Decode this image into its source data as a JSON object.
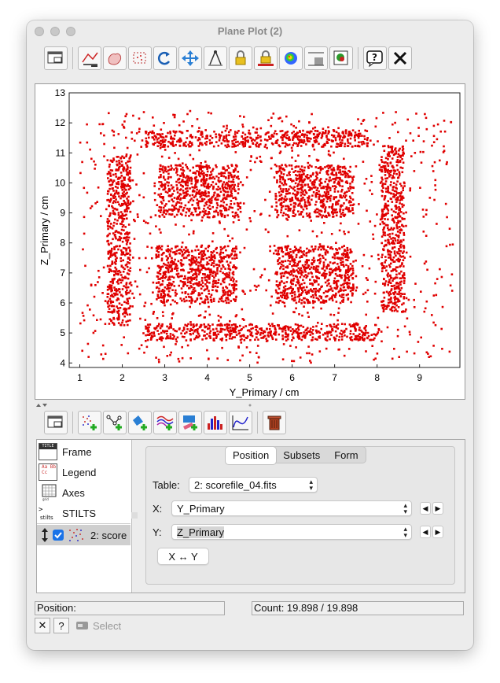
{
  "window": {
    "title": "Plane Plot (2)"
  },
  "toolbar": {
    "buttons": [
      "window-icon",
      "axis-lines-icon",
      "blob-icon",
      "box-select-icon",
      "redraw-icon",
      "pan-zoom-icon",
      "axes-rescale-icon",
      "lock-icon",
      "aux-lock-icon",
      "color-ramp-icon",
      "grid-icon",
      "export-icon",
      "help-icon",
      "close-icon"
    ]
  },
  "plot": {
    "xlabel": "Y_Primary / cm",
    "ylabel": "Z_Primary / cm",
    "xticks": [
      "1",
      "2",
      "3",
      "4",
      "5",
      "6",
      "7",
      "8",
      "9"
    ],
    "yticks": [
      "4",
      "5",
      "6",
      "7",
      "8",
      "9",
      "10",
      "11",
      "12",
      "13"
    ],
    "xlim": [
      0.75,
      9.95
    ],
    "ylim": [
      3.85,
      13.0
    ],
    "point_color": "#e00000"
  },
  "chart_data": {
    "type": "scatter",
    "title": "",
    "xlabel": "Y_Primary / cm",
    "ylabel": "Z_Primary / cm",
    "xlim": [
      0.75,
      9.95
    ],
    "ylim": [
      3.85,
      13.0
    ],
    "grid": false,
    "series": [
      {
        "color": "#e00000",
        "dense_regions": [
          {
            "x": [
              2.55,
              7.8
            ],
            "y": [
              11.2,
              11.75
            ]
          },
          {
            "x": [
              1.65,
              2.2
            ],
            "y": [
              5.25,
              10.95
            ]
          },
          {
            "x": [
              8.1,
              8.65
            ],
            "y": [
              5.7,
              11.25
            ]
          },
          {
            "x": [
              2.55,
              8.05
            ],
            "y": [
              4.75,
              5.3
            ]
          },
          {
            "x": [
              2.85,
              4.75
            ],
            "y": [
              8.85,
              10.6
            ]
          },
          {
            "x": [
              5.6,
              7.45
            ],
            "y": [
              8.85,
              10.6
            ]
          },
          {
            "x": [
              2.8,
              4.7
            ],
            "y": [
              6.0,
              7.9
            ]
          },
          {
            "x": [
              5.6,
              7.45
            ],
            "y": [
              6.0,
              7.9
            ]
          }
        ]
      }
    ]
  },
  "layerbar": {
    "buttons": [
      "window-icon",
      "add-marks-layer-icon",
      "add-pair-layer-icon",
      "add-area-layer-icon",
      "add-function-layer-icon",
      "add-region-layer-icon",
      "add-histogram-layer-icon",
      "add-analytic-layer-icon",
      "delete-layer-icon"
    ]
  },
  "stack": {
    "items": [
      {
        "label": "Frame",
        "icon": "TITLE"
      },
      {
        "label": "Legend",
        "icon": "Aa Bb Cc"
      },
      {
        "label": "Axes",
        "icon": "grid"
      },
      {
        "label": "STILTS",
        "icon": "stilts"
      }
    ],
    "layer": {
      "label": "2: score",
      "checked": true
    }
  },
  "config": {
    "tabs": [
      "Position",
      "Subsets",
      "Form"
    ],
    "active_tab": "Position",
    "table_label": "Table:",
    "table_value": "2: scorefile_04.fits",
    "x_label": "X:",
    "x_value": "Y_Primary",
    "y_label": "Y:",
    "y_value": "Z_Primary",
    "swap_label": "X ↔ Y"
  },
  "status": {
    "position_label": "Position:",
    "count_text": "Count: 19.898 / 19.898"
  },
  "bottom": {
    "select_label": "Select",
    "close_label": "✕",
    "help_label": "?"
  }
}
